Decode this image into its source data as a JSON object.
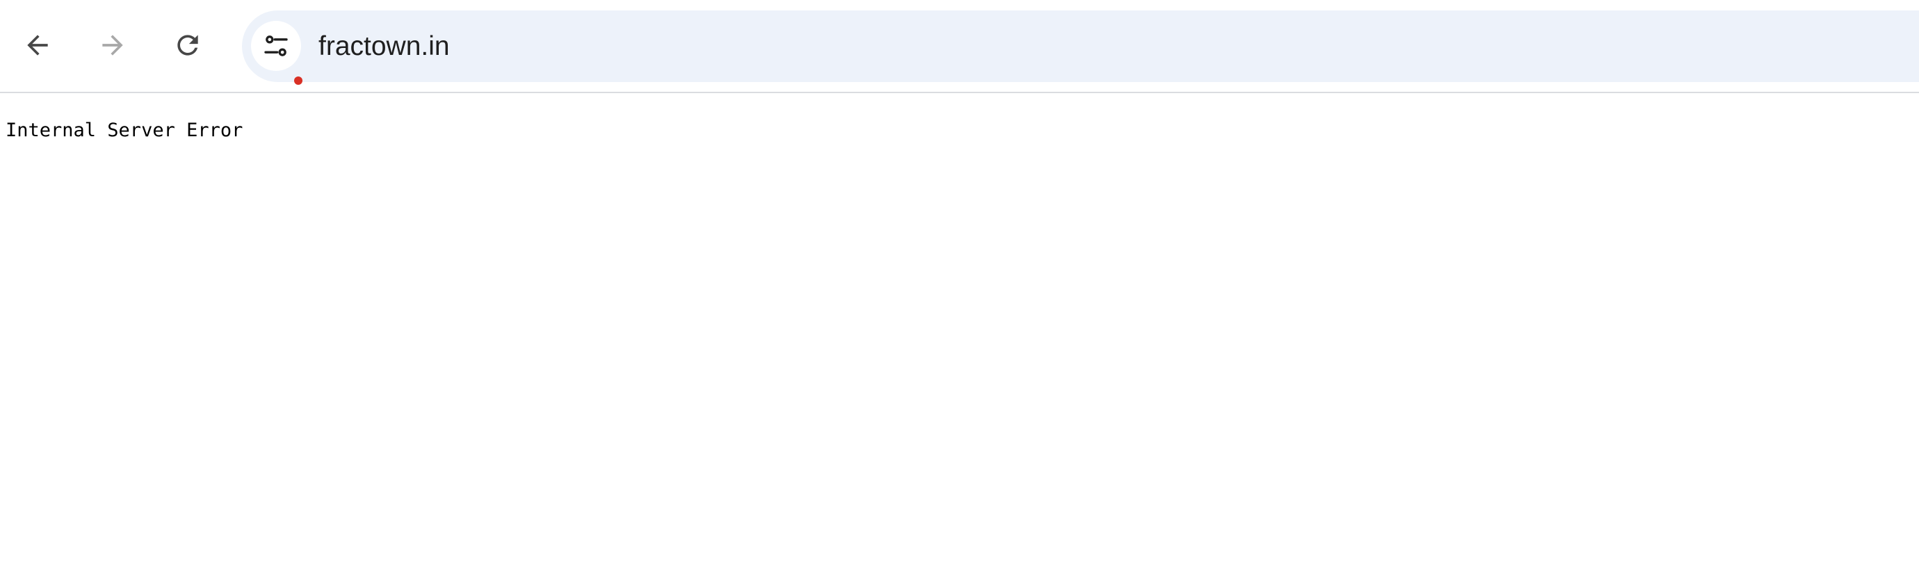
{
  "browser": {
    "toolbar": {
      "back_icon": "arrow-left-icon",
      "forward_icon": "arrow-right-icon",
      "reload_icon": "reload-icon",
      "forward_enabled": false
    },
    "omnibox": {
      "site_info_icon": "tune-icon",
      "url": "fractown.in",
      "alert_color": "#d93025",
      "background_color": "#edf2fa"
    }
  },
  "page": {
    "body_text": "Internal Server Error"
  }
}
